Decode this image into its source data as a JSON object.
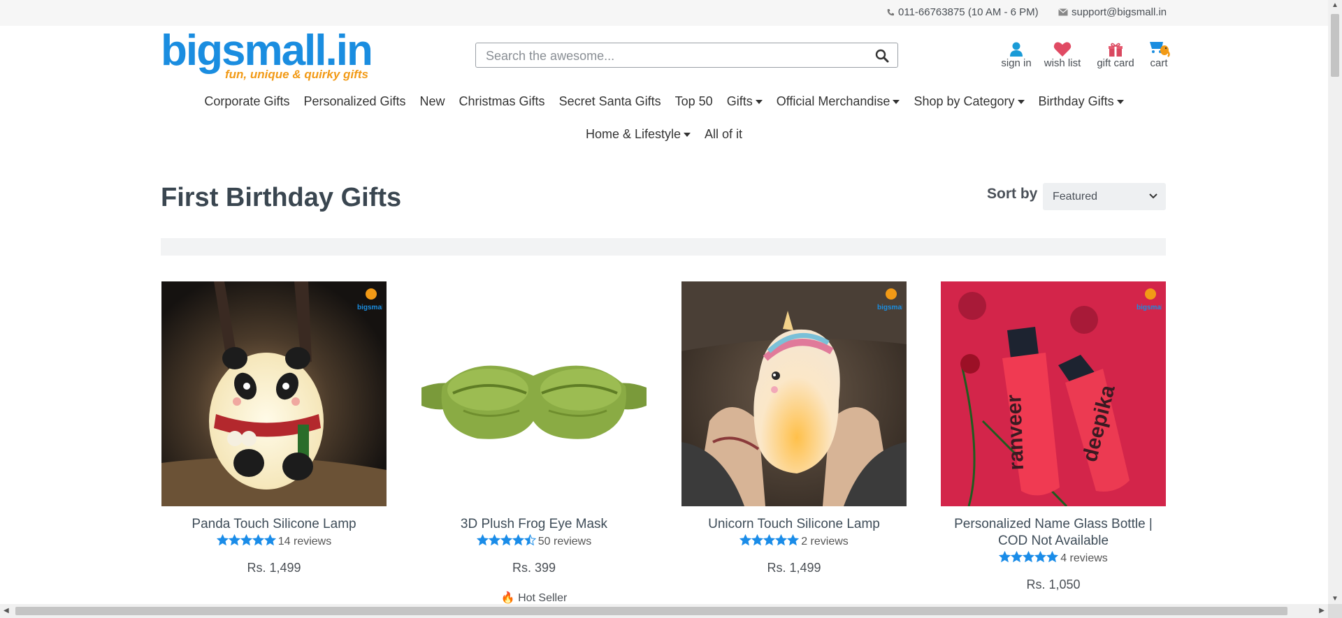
{
  "topbar": {
    "phone": "011-66763875 (10 AM - 6 PM)",
    "email": "support@bigsmall.in"
  },
  "logo": {
    "wordmark": "bigsmall.in",
    "tagline": "fun, unique & quirky gifts"
  },
  "search": {
    "placeholder": "Search the awesome..."
  },
  "account": {
    "sign_in": "sign in",
    "wish_list": "wish list",
    "gift_card": "gift card",
    "cart": "cart"
  },
  "nav_row1": [
    {
      "label": "Corporate Gifts",
      "dropdown": false
    },
    {
      "label": "Personalized Gifts",
      "dropdown": false
    },
    {
      "label": "New",
      "dropdown": false
    },
    {
      "label": "Christmas Gifts",
      "dropdown": false
    },
    {
      "label": "Secret Santa Gifts",
      "dropdown": false
    },
    {
      "label": "Top 50",
      "dropdown": false
    },
    {
      "label": "Gifts",
      "dropdown": true
    },
    {
      "label": "Official Merchandise",
      "dropdown": true
    },
    {
      "label": "Shop by Category",
      "dropdown": true
    },
    {
      "label": "Birthday Gifts",
      "dropdown": true
    }
  ],
  "nav_row2": [
    {
      "label": "Home & Lifestyle",
      "dropdown": true
    },
    {
      "label": "All of it",
      "dropdown": false
    }
  ],
  "page": {
    "title": "First Birthday Gifts",
    "sort_label": "Sort by",
    "sort_value": "Featured"
  },
  "products": [
    {
      "name": "Panda Touch Silicone Lamp",
      "stars": 5,
      "reviews": "14 reviews",
      "price": "Rs. 1,499",
      "badge": ""
    },
    {
      "name": "3D Plush Frog Eye Mask",
      "stars": 4.5,
      "reviews": "50 reviews",
      "price": "Rs. 399",
      "badge": "Hot Seller"
    },
    {
      "name": "Unicorn Touch Silicone Lamp",
      "stars": 5,
      "reviews": "2 reviews",
      "price": "Rs. 1,499",
      "badge": ""
    },
    {
      "name": "Personalized Name Glass Bottle | COD Not Available",
      "stars": 5,
      "reviews": "4 reviews",
      "price": "Rs. 1,050",
      "badge": ""
    }
  ],
  "bottle_names": [
    "ranveer",
    "deepika"
  ],
  "colors": {
    "brand_blue": "#1a8de0",
    "brand_orange": "#f29a16",
    "star_blue": "#1a8ce8",
    "heart_red": "#e04a63",
    "gift_red": "#d9485f"
  }
}
